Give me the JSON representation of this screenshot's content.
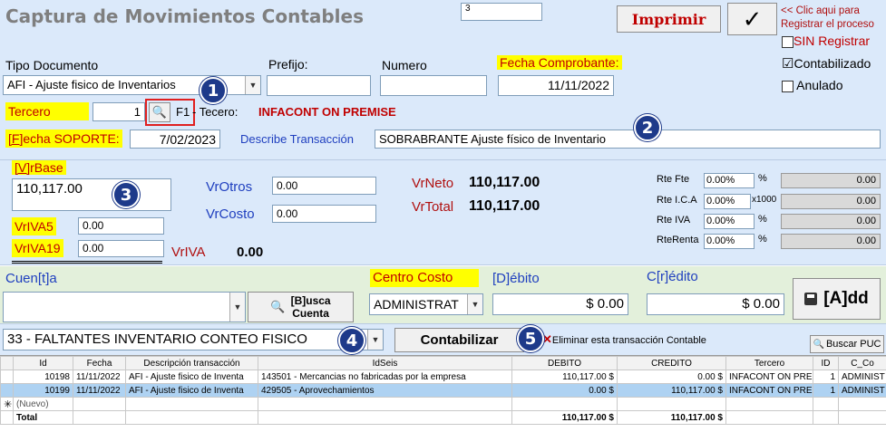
{
  "header": {
    "title": "Captura de Movimientos Contables",
    "counter": "3",
    "print_label": "Imprimir",
    "confirm_hint": "<< Clic aqui para Registrar el proceso"
  },
  "flags": {
    "sin_registrar": "SIN Registrar",
    "contabilizado": "Contabilizado",
    "anulado": "Anulado",
    "contabilizado_checked": "☑"
  },
  "doc": {
    "tipo_label": "Tipo Documento",
    "tipo_value": "AFI - Ajuste fisico de Inventarios",
    "prefijo_label": "Prefijo:",
    "prefijo_value": "",
    "numero_label": "Numero",
    "numero_value": "",
    "fecha_label": "Fecha Comprobante:",
    "fecha_value": "11/11/2022"
  },
  "tercero": {
    "label": "Tercero",
    "value": "1",
    "key_hint": "F1",
    "name_label": "- Tecero:",
    "name": "INFACONT ON PREMISE"
  },
  "soporte": {
    "label_key": "[F]",
    "label_rest": "echa SOPORTE:",
    "date": "7/02/2023",
    "describe_label": "Describe Transacción",
    "describe_value": "SOBRABRANTE Ajuste físico de Inventario"
  },
  "values": {
    "vrbase_key": "[V]",
    "vrbase_rest": "rBase",
    "vrbase": "110,117.00",
    "vriva5_label": "VrIVA5",
    "vriva5": "0.00",
    "vriva19_label": "VrIVA19",
    "vriva19": "0.00",
    "vriva_label": "VrIVA",
    "vriva": "0.00",
    "vrotros_label": "VrOtros",
    "vrotros": "0.00",
    "vrcosto_label": "VrCosto",
    "vrcosto": "0.00",
    "vrneto_label": "VrNeto",
    "vrneto": "110,117.00",
    "vrtotal_label": "VrTotal",
    "vrtotal": "110,117.00"
  },
  "retenciones": [
    {
      "label": "Rte Fte",
      "pct": "0.00%",
      "unit": "%",
      "value": "0.00"
    },
    {
      "label": "Rte I.C.A",
      "pct": "0.00%",
      "unit": "x1000",
      "value": "0.00"
    },
    {
      "label": "Rte IVA",
      "pct": "0.00%",
      "unit": "%",
      "value": "0.00"
    },
    {
      "label": "RteRenta",
      "pct": "0.00%",
      "unit": "%",
      "value": "0.00"
    }
  ],
  "cuenta": {
    "label": "Cuen[t]a",
    "value": "",
    "busca_line1": "[B]usca",
    "busca_line2": "Cuenta",
    "centro_label": "Centro Costo",
    "centro_value": "ADMINISTRAT",
    "debito_label": "[D]ébito",
    "debito_value": "$ 0.00",
    "credito_label": "C[r]édito",
    "credito_value": "$ 0.00",
    "add_label": "[A]dd"
  },
  "bar": {
    "plantilla": "33 - FALTANTES INVENTARIO CONTEO FISICO",
    "contabilizar": "Contabilizar",
    "eliminar": "Eliminar esta transacción Contable",
    "buscar_puc": "Buscar PUC"
  },
  "badges": [
    "1",
    "2",
    "3",
    "4",
    "5"
  ],
  "grid": {
    "columns": [
      "Id",
      "Fecha",
      "Descripción transacción",
      "IdSeis",
      "DEBITO",
      "CREDITO",
      "Tercero",
      "ID",
      "C_Co"
    ],
    "rows": [
      [
        "10198",
        "11/11/2022",
        "AFI - Ajuste fisico de Inventa",
        "143501 - Mercancias no fabricadas por la empresa",
        "110,117.00 $",
        "0.00 $",
        "INFACONT ON PRE",
        "1",
        "ADMINIST"
      ],
      [
        "10199",
        "11/11/2022",
        "AFI - Ajuste fisico de Inventa",
        "429505 - Aprovechamientos",
        "0.00 $",
        "110,117.00 $",
        "INFACONT ON PRE",
        "1",
        "ADMINIST"
      ]
    ],
    "new_row": "(Nuevo)",
    "total_label": "Total",
    "total_debito": "110,117.00 $",
    "total_credito": "110,117.00 $"
  }
}
